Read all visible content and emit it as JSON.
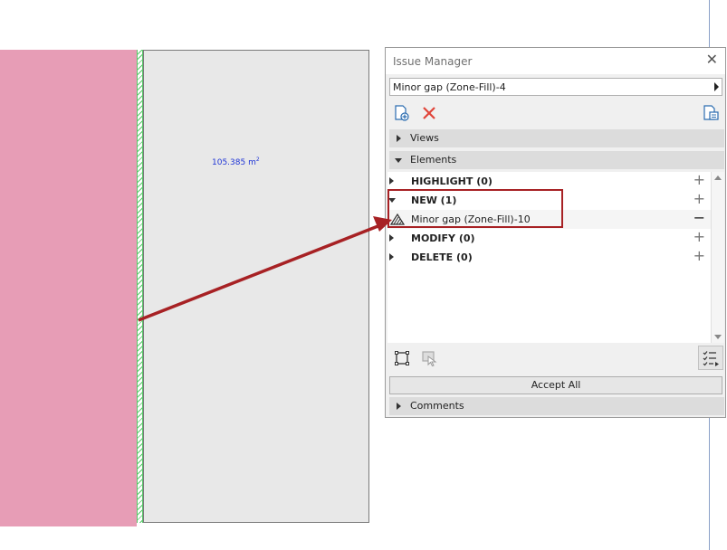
{
  "canvas": {
    "area_value": "105.385 m",
    "area_unit_exponent": "2"
  },
  "panel": {
    "title": "Issue Manager",
    "close_glyph": "✕",
    "issue_selected": "Minor gap (Zone-Fill)-4",
    "sections": {
      "views_label": "Views",
      "elements_label": "Elements",
      "comments_label": "Comments"
    },
    "groups": [
      {
        "label": "HIGHLIGHT (0)",
        "action": "+"
      },
      {
        "label": "NEW (1)",
        "action": "+"
      },
      {
        "label": "MODIFY (0)",
        "action": "+"
      },
      {
        "label": "DELETE (0)",
        "action": "+"
      }
    ],
    "new_item": {
      "label": "Minor gap (Zone-Fill)-10",
      "action": "−"
    },
    "accept_all_label": "Accept All",
    "icons": [
      "new-issue-icon",
      "delete-issue-icon",
      "issue-list-icon",
      "select-element-icon",
      "highlight-element-icon",
      "checklist-icon",
      "element-type-icon"
    ]
  },
  "colors": {
    "accent_red": "#a72124",
    "delete_red": "#e0453a",
    "zone_pink": "#e79db6",
    "area_blue": "#1f35d6"
  }
}
